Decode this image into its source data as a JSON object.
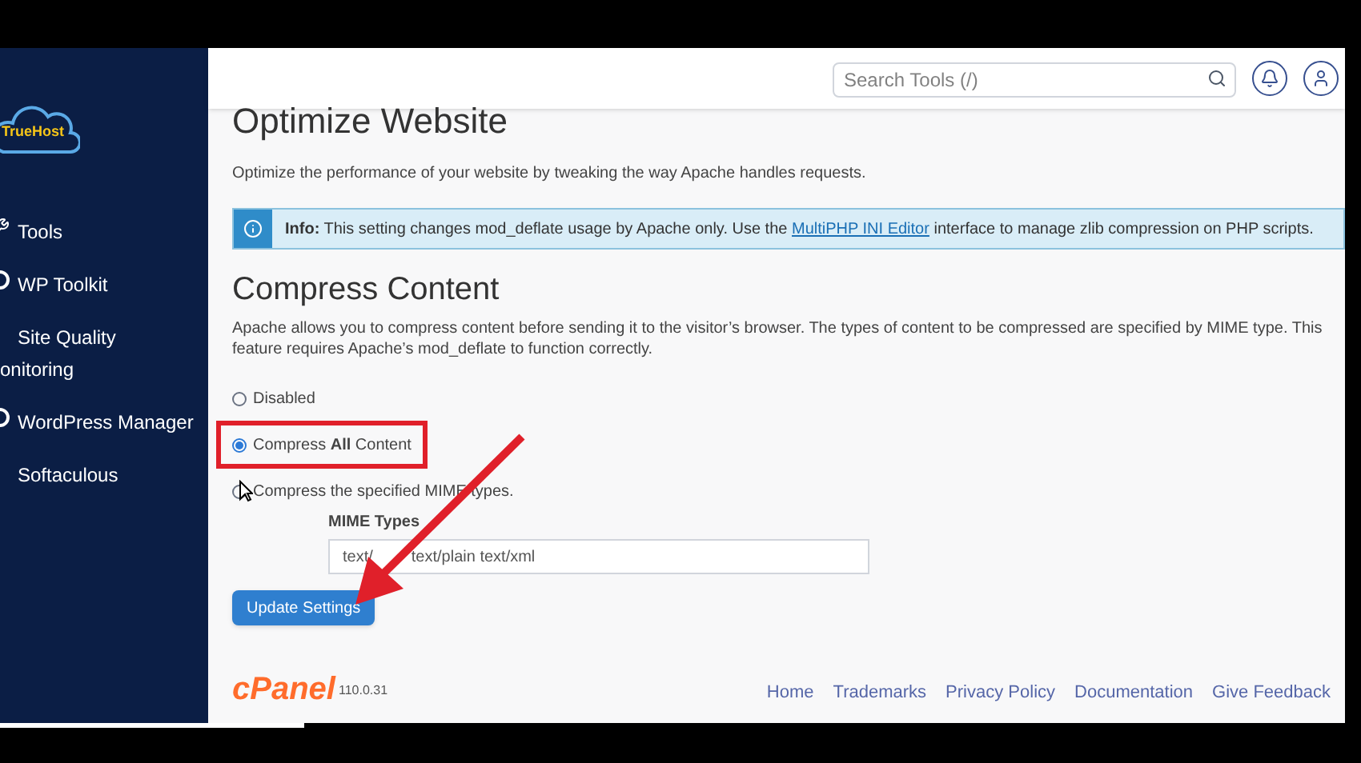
{
  "sidebar": {
    "logo": "TrueHost",
    "items": [
      {
        "label": "Tools"
      },
      {
        "label": "WP Toolkit"
      },
      {
        "label": "Site Quality",
        "continuation": "onitoring"
      },
      {
        "label": "WordPress Manager"
      },
      {
        "label": "Softaculous"
      }
    ]
  },
  "header": {
    "search": {
      "placeholder": "Search Tools (/)"
    }
  },
  "page": {
    "title": "Optimize Website",
    "description": "Optimize the performance of your website by tweaking the way Apache handles requests.",
    "info": {
      "label": "Info:",
      "before": "This setting changes mod_deflate usage by Apache only. Use the",
      "link": "MultiPHP INI Editor",
      "after": "interface to manage zlib compression on PHP scripts."
    },
    "section_title": "Compress Content",
    "section_description": "Apache allows you to compress content before sending it to the visitor’s browser. The types of content to be compressed are specified by MIME type. This feature requires Apache’s mod_deflate to function correctly.",
    "options": [
      {
        "label": "Disabled",
        "selected": false,
        "highlighted": false
      },
      {
        "label": "Compress **All** Content",
        "selected": true,
        "highlighted": true
      },
      {
        "label": "Compress the specified MIME types.",
        "selected": false,
        "highlighted": false
      }
    ],
    "mime_label": "MIME Types",
    "mime_value": {
      "before_arrow": "text/",
      "after_arrow": "text/plain text/xml"
    },
    "button": "Update Settings"
  },
  "footer": {
    "logo": "cPanel",
    "version": "110.0.31",
    "links": [
      "Home",
      "Trademarks",
      "Privacy Policy",
      "Documentation",
      "Give Feedback"
    ]
  }
}
